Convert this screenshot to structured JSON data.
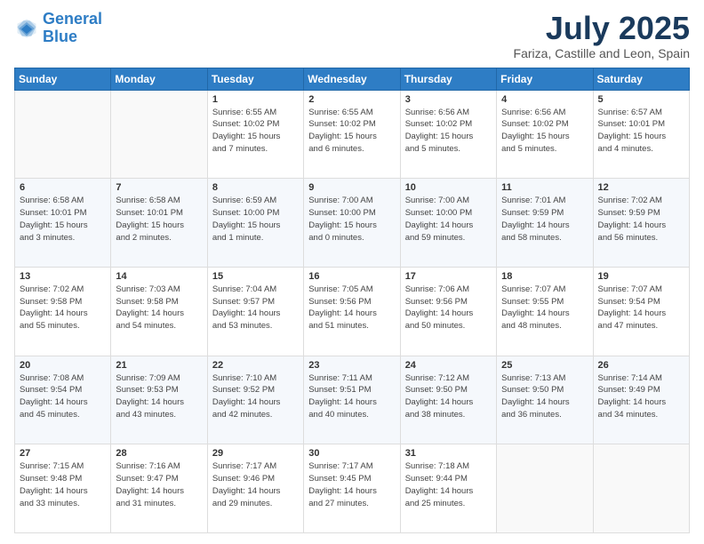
{
  "header": {
    "logo_line1": "General",
    "logo_line2": "Blue",
    "month": "July 2025",
    "location": "Fariza, Castille and Leon, Spain"
  },
  "weekdays": [
    "Sunday",
    "Monday",
    "Tuesday",
    "Wednesday",
    "Thursday",
    "Friday",
    "Saturday"
  ],
  "weeks": [
    [
      {
        "day": "",
        "info": ""
      },
      {
        "day": "",
        "info": ""
      },
      {
        "day": "1",
        "info": "Sunrise: 6:55 AM\nSunset: 10:02 PM\nDaylight: 15 hours\nand 7 minutes."
      },
      {
        "day": "2",
        "info": "Sunrise: 6:55 AM\nSunset: 10:02 PM\nDaylight: 15 hours\nand 6 minutes."
      },
      {
        "day": "3",
        "info": "Sunrise: 6:56 AM\nSunset: 10:02 PM\nDaylight: 15 hours\nand 5 minutes."
      },
      {
        "day": "4",
        "info": "Sunrise: 6:56 AM\nSunset: 10:02 PM\nDaylight: 15 hours\nand 5 minutes."
      },
      {
        "day": "5",
        "info": "Sunrise: 6:57 AM\nSunset: 10:01 PM\nDaylight: 15 hours\nand 4 minutes."
      }
    ],
    [
      {
        "day": "6",
        "info": "Sunrise: 6:58 AM\nSunset: 10:01 PM\nDaylight: 15 hours\nand 3 minutes."
      },
      {
        "day": "7",
        "info": "Sunrise: 6:58 AM\nSunset: 10:01 PM\nDaylight: 15 hours\nand 2 minutes."
      },
      {
        "day": "8",
        "info": "Sunrise: 6:59 AM\nSunset: 10:00 PM\nDaylight: 15 hours\nand 1 minute."
      },
      {
        "day": "9",
        "info": "Sunrise: 7:00 AM\nSunset: 10:00 PM\nDaylight: 15 hours\nand 0 minutes."
      },
      {
        "day": "10",
        "info": "Sunrise: 7:00 AM\nSunset: 10:00 PM\nDaylight: 14 hours\nand 59 minutes."
      },
      {
        "day": "11",
        "info": "Sunrise: 7:01 AM\nSunset: 9:59 PM\nDaylight: 14 hours\nand 58 minutes."
      },
      {
        "day": "12",
        "info": "Sunrise: 7:02 AM\nSunset: 9:59 PM\nDaylight: 14 hours\nand 56 minutes."
      }
    ],
    [
      {
        "day": "13",
        "info": "Sunrise: 7:02 AM\nSunset: 9:58 PM\nDaylight: 14 hours\nand 55 minutes."
      },
      {
        "day": "14",
        "info": "Sunrise: 7:03 AM\nSunset: 9:58 PM\nDaylight: 14 hours\nand 54 minutes."
      },
      {
        "day": "15",
        "info": "Sunrise: 7:04 AM\nSunset: 9:57 PM\nDaylight: 14 hours\nand 53 minutes."
      },
      {
        "day": "16",
        "info": "Sunrise: 7:05 AM\nSunset: 9:56 PM\nDaylight: 14 hours\nand 51 minutes."
      },
      {
        "day": "17",
        "info": "Sunrise: 7:06 AM\nSunset: 9:56 PM\nDaylight: 14 hours\nand 50 minutes."
      },
      {
        "day": "18",
        "info": "Sunrise: 7:07 AM\nSunset: 9:55 PM\nDaylight: 14 hours\nand 48 minutes."
      },
      {
        "day": "19",
        "info": "Sunrise: 7:07 AM\nSunset: 9:54 PM\nDaylight: 14 hours\nand 47 minutes."
      }
    ],
    [
      {
        "day": "20",
        "info": "Sunrise: 7:08 AM\nSunset: 9:54 PM\nDaylight: 14 hours\nand 45 minutes."
      },
      {
        "day": "21",
        "info": "Sunrise: 7:09 AM\nSunset: 9:53 PM\nDaylight: 14 hours\nand 43 minutes."
      },
      {
        "day": "22",
        "info": "Sunrise: 7:10 AM\nSunset: 9:52 PM\nDaylight: 14 hours\nand 42 minutes."
      },
      {
        "day": "23",
        "info": "Sunrise: 7:11 AM\nSunset: 9:51 PM\nDaylight: 14 hours\nand 40 minutes."
      },
      {
        "day": "24",
        "info": "Sunrise: 7:12 AM\nSunset: 9:50 PM\nDaylight: 14 hours\nand 38 minutes."
      },
      {
        "day": "25",
        "info": "Sunrise: 7:13 AM\nSunset: 9:50 PM\nDaylight: 14 hours\nand 36 minutes."
      },
      {
        "day": "26",
        "info": "Sunrise: 7:14 AM\nSunset: 9:49 PM\nDaylight: 14 hours\nand 34 minutes."
      }
    ],
    [
      {
        "day": "27",
        "info": "Sunrise: 7:15 AM\nSunset: 9:48 PM\nDaylight: 14 hours\nand 33 minutes."
      },
      {
        "day": "28",
        "info": "Sunrise: 7:16 AM\nSunset: 9:47 PM\nDaylight: 14 hours\nand 31 minutes."
      },
      {
        "day": "29",
        "info": "Sunrise: 7:17 AM\nSunset: 9:46 PM\nDaylight: 14 hours\nand 29 minutes."
      },
      {
        "day": "30",
        "info": "Sunrise: 7:17 AM\nSunset: 9:45 PM\nDaylight: 14 hours\nand 27 minutes."
      },
      {
        "day": "31",
        "info": "Sunrise: 7:18 AM\nSunset: 9:44 PM\nDaylight: 14 hours\nand 25 minutes."
      },
      {
        "day": "",
        "info": ""
      },
      {
        "day": "",
        "info": ""
      }
    ]
  ]
}
